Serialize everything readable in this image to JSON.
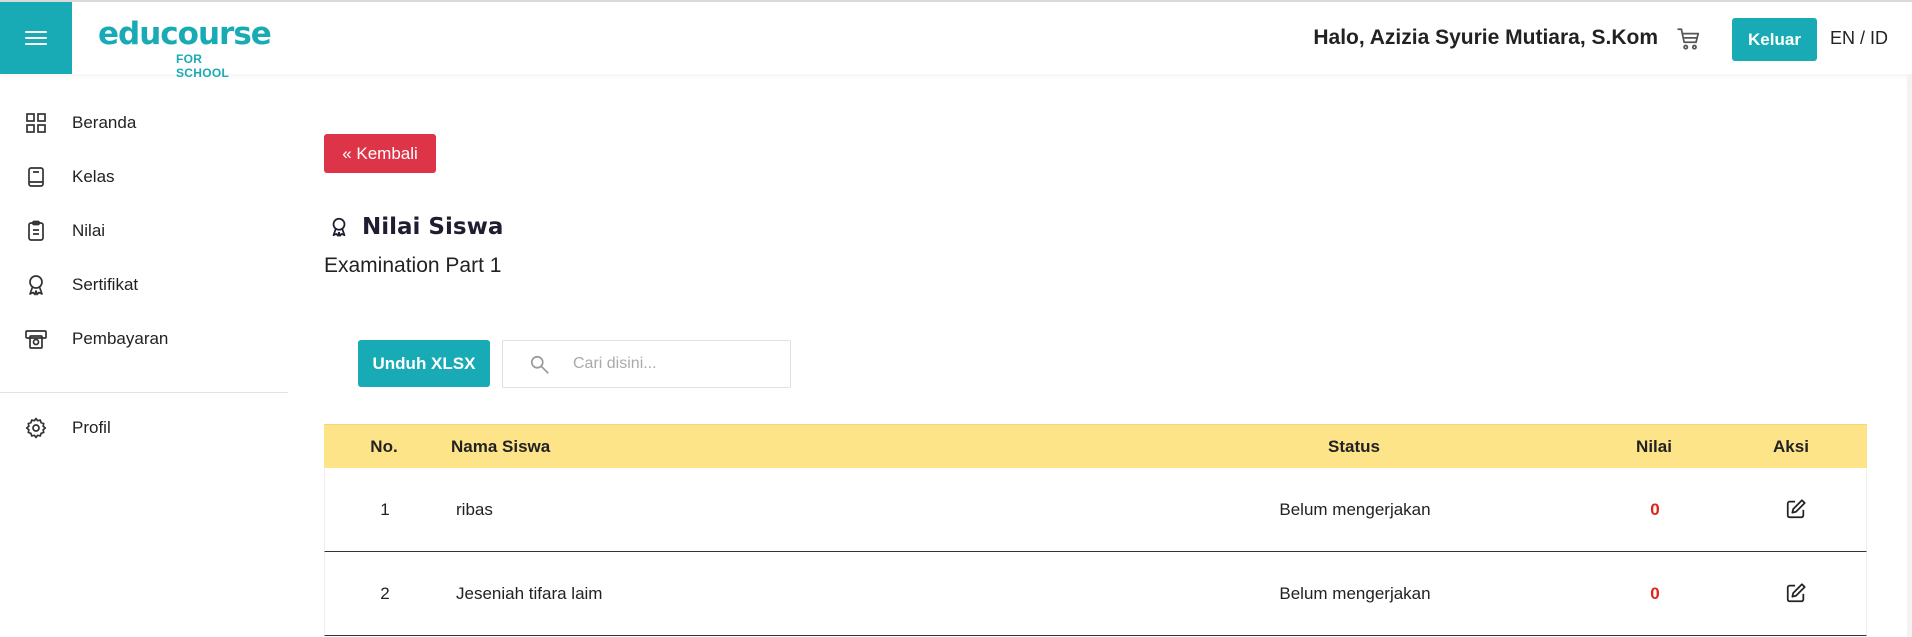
{
  "header": {
    "logo_text": "educourse",
    "logo_sub": "FOR SCHOOL",
    "greeting": "Halo, Azizia Syurie Mutiara, S.Kom",
    "logout_label": "Keluar",
    "language": "EN / ID",
    "icons": [
      "menu-icon",
      "cart-icon"
    ]
  },
  "sidebar": {
    "items": [
      {
        "label": "Beranda",
        "icon": "dashboard-grid-icon"
      },
      {
        "label": "Kelas",
        "icon": "book-icon"
      },
      {
        "label": "Nilai",
        "icon": "clipboard-icon"
      },
      {
        "label": "Sertifikat",
        "icon": "award-icon"
      },
      {
        "label": "Pembayaran",
        "icon": "payment-icon"
      },
      {
        "label": "Profil",
        "icon": "gear-icon"
      }
    ]
  },
  "main": {
    "back_label": "« Kembali",
    "title": "Nilai Siswa",
    "subtitle": "Examination Part 1",
    "download_label": "Unduh XLSX",
    "search_placeholder": "Cari disini..."
  },
  "table": {
    "headers": {
      "no": "No.",
      "name": "Nama Siswa",
      "status": "Status",
      "score": "Nilai",
      "action": "Aksi"
    },
    "rows": [
      {
        "no": "1",
        "name": "ribas",
        "status": "Belum mengerjakan",
        "score": "0"
      },
      {
        "no": "2",
        "name": "Jeseniah tifara laim",
        "status": "Belum mengerjakan",
        "score": "0"
      }
    ]
  },
  "colors": {
    "accent": "#19abb5",
    "danger": "#dd3547",
    "table_header": "#fee489",
    "score": "#e0241c"
  }
}
